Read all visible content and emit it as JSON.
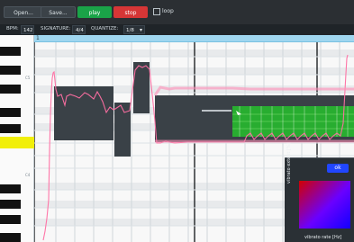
{
  "toolbar": {
    "open_label": "Open...",
    "save_label": "Save...",
    "play_label": "play",
    "stop_label": "stop",
    "loop_label": "loop"
  },
  "info": {
    "bpm_label": "BPM:",
    "bpm_value": "142",
    "signature_label": "SIGNATURE:",
    "signature_value": "4/4",
    "quantize_label": "QUANTIZE:",
    "quantize_value": "1/8"
  },
  "piano": {
    "octave_labels": [
      "C5",
      "C4"
    ]
  },
  "timeline": {
    "marker": "1"
  },
  "vibrato_panel": {
    "ok_label": "ok",
    "x_label": "vibrato rate [Hz]",
    "y_label": "vibrato extent [%]"
  },
  "colors": {
    "topbar": "#2b2f33",
    "play": "#1aa348",
    "stop": "#d63636",
    "ruler": "#9fd6ef",
    "note": "#3a4147",
    "note_selected": "#2e8f2e",
    "pitch_line": "#ff6fa3",
    "highlight_key": "#f1ef0a"
  }
}
